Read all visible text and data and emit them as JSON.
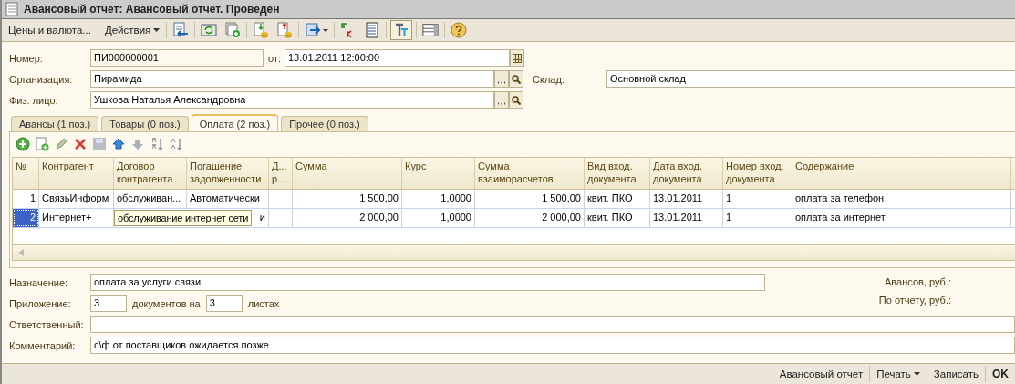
{
  "window": {
    "title": "Авансовый отчет: Авансовый отчет. Проведен"
  },
  "toolbar": {
    "prices_button": "Цены и валюта...",
    "actions_button": "Действия",
    "structure_toggle": {
      "on": true
    }
  },
  "header": {
    "number_label": "Номер:",
    "number": "ПИ000000001",
    "date_label": "от:",
    "date": "13.01.2011 12:00:00",
    "org_label": "Организация:",
    "org": "Пирамида",
    "warehouse_label": "Склад:",
    "warehouse": "Основной склад",
    "person_label": "Физ. лицо:",
    "person": "Ушкова Наталья Александровна"
  },
  "tabs": [
    {
      "label": "Авансы (1 поз.)",
      "selected": false
    },
    {
      "label": "Товары (0 поз.)",
      "selected": false
    },
    {
      "label": "Оплата (2 поз.)",
      "selected": true
    },
    {
      "label": "Прочее (0 поз.)",
      "selected": false
    }
  ],
  "table": {
    "columns": [
      "№",
      "Контрагент",
      "Договор контрагента",
      "Погашение задолженности",
      "Д... р...",
      "Сумма",
      "Курс",
      "Сумма взаиморасчетов",
      "Вид вход. документа",
      "Дата вход. документа",
      "Номер вход. документа",
      "Содержание"
    ],
    "rows": [
      {
        "selected": false,
        "cells": [
          "1",
          "СвязьИнформ",
          "обслуживан...",
          "Автоматически",
          null,
          "1 500,00",
          "1,0000",
          "1 500,00",
          "квит. ПКО",
          "13.01.2011",
          "1",
          "оплата за телефон"
        ]
      },
      {
        "selected": true,
        "tooltip": "обслуживание интернет сети",
        "cells": [
          "2",
          "Интернет+",
          null,
          "и",
          null,
          "2 000,00",
          "1,0000",
          "2 000,00",
          "квит. ПКО",
          "13.01.2011",
          "1",
          "оплата за интернет"
        ]
      }
    ]
  },
  "footer_fields": {
    "purpose_label": "Назначение:",
    "purpose": "оплата за услуги связи",
    "attachment_label": "Приложение:",
    "docs_count": "3",
    "docs_text": "документов на",
    "sheets_count": "3",
    "sheets_text": "листах",
    "responsible_label": "Ответственный:",
    "comment_label": "Комментарий:",
    "comment": "с\\ф от поставщиков ожидается позже",
    "advances_label": "Авансов, руб.:",
    "report_label": "По отчету, руб.:"
  },
  "buttons": [
    {
      "label": "Авансовый отчет",
      "kind": "plain"
    },
    {
      "label": "Печать",
      "kind": "menu"
    },
    {
      "label": "Записать",
      "kind": "plain"
    },
    {
      "label": "OK",
      "kind": "default"
    }
  ]
}
